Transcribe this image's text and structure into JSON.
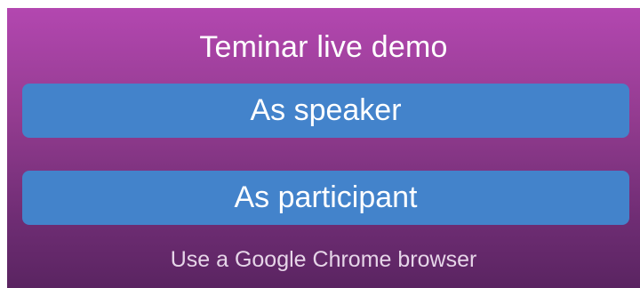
{
  "header": {
    "title": "Teminar live demo"
  },
  "actions": {
    "speaker_label": "As speaker",
    "participant_label": "As participant"
  },
  "footer": {
    "hint": "Use a Google Chrome browser"
  },
  "colors": {
    "panel_gradient_top": "#b347b0",
    "panel_gradient_bottom": "#5a2461",
    "button_bg": "#4383cb",
    "text": "#ffffff"
  }
}
